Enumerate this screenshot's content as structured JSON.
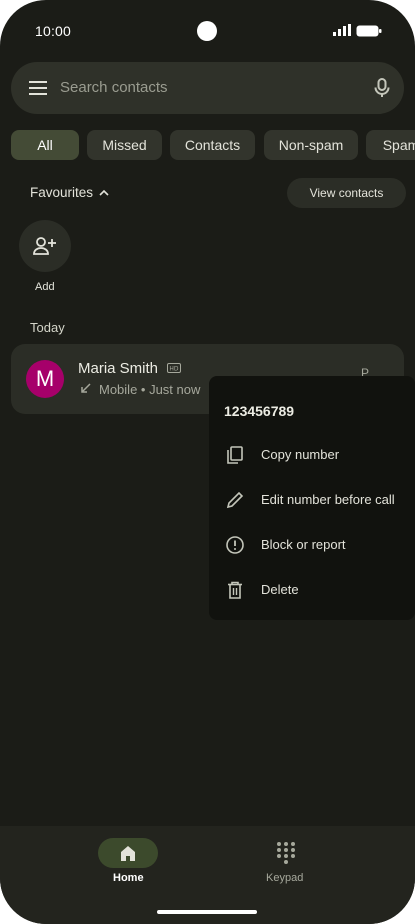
{
  "status_bar": {
    "time": "10:00"
  },
  "search": {
    "placeholder": "Search contacts"
  },
  "filters": {
    "chips": [
      {
        "label": "All",
        "selected": true
      },
      {
        "label": "Missed",
        "selected": false
      },
      {
        "label": "Contacts",
        "selected": false
      },
      {
        "label": "Non-spam",
        "selected": false
      },
      {
        "label": "Spam",
        "selected": false
      }
    ]
  },
  "favourites": {
    "title": "Favourites",
    "view_contacts_label": "View contacts",
    "add_label": "Add"
  },
  "recents": {
    "section_title": "Today",
    "calls": [
      {
        "avatar_letter": "M",
        "avatar_color": "#a6006a",
        "name": "Maria Smith",
        "badge_icon": "hd-icon",
        "direction_icon": "incoming-call-arrow-icon",
        "meta": "Mobile • Just now",
        "action_partial": "P"
      }
    ]
  },
  "context_menu": {
    "number": "123456789",
    "items": [
      {
        "label": "Copy number",
        "icon": "copy-icon"
      },
      {
        "label": "Edit number before call",
        "icon": "pencil-icon"
      },
      {
        "label": "Block or report",
        "icon": "alert-circle-icon"
      },
      {
        "label": "Delete",
        "icon": "trash-icon"
      }
    ]
  },
  "bottom_nav": {
    "items": [
      {
        "label": "Home",
        "icon": "home-icon",
        "active": true
      },
      {
        "label": "Keypad",
        "icon": "keypad-icon",
        "active": false
      }
    ]
  },
  "colors": {
    "background": "#1b1c17",
    "surface": "#2b2d26",
    "selected_chip": "#444b36",
    "menu_background": "#11120e",
    "active_nav": "#3c4a2c"
  }
}
